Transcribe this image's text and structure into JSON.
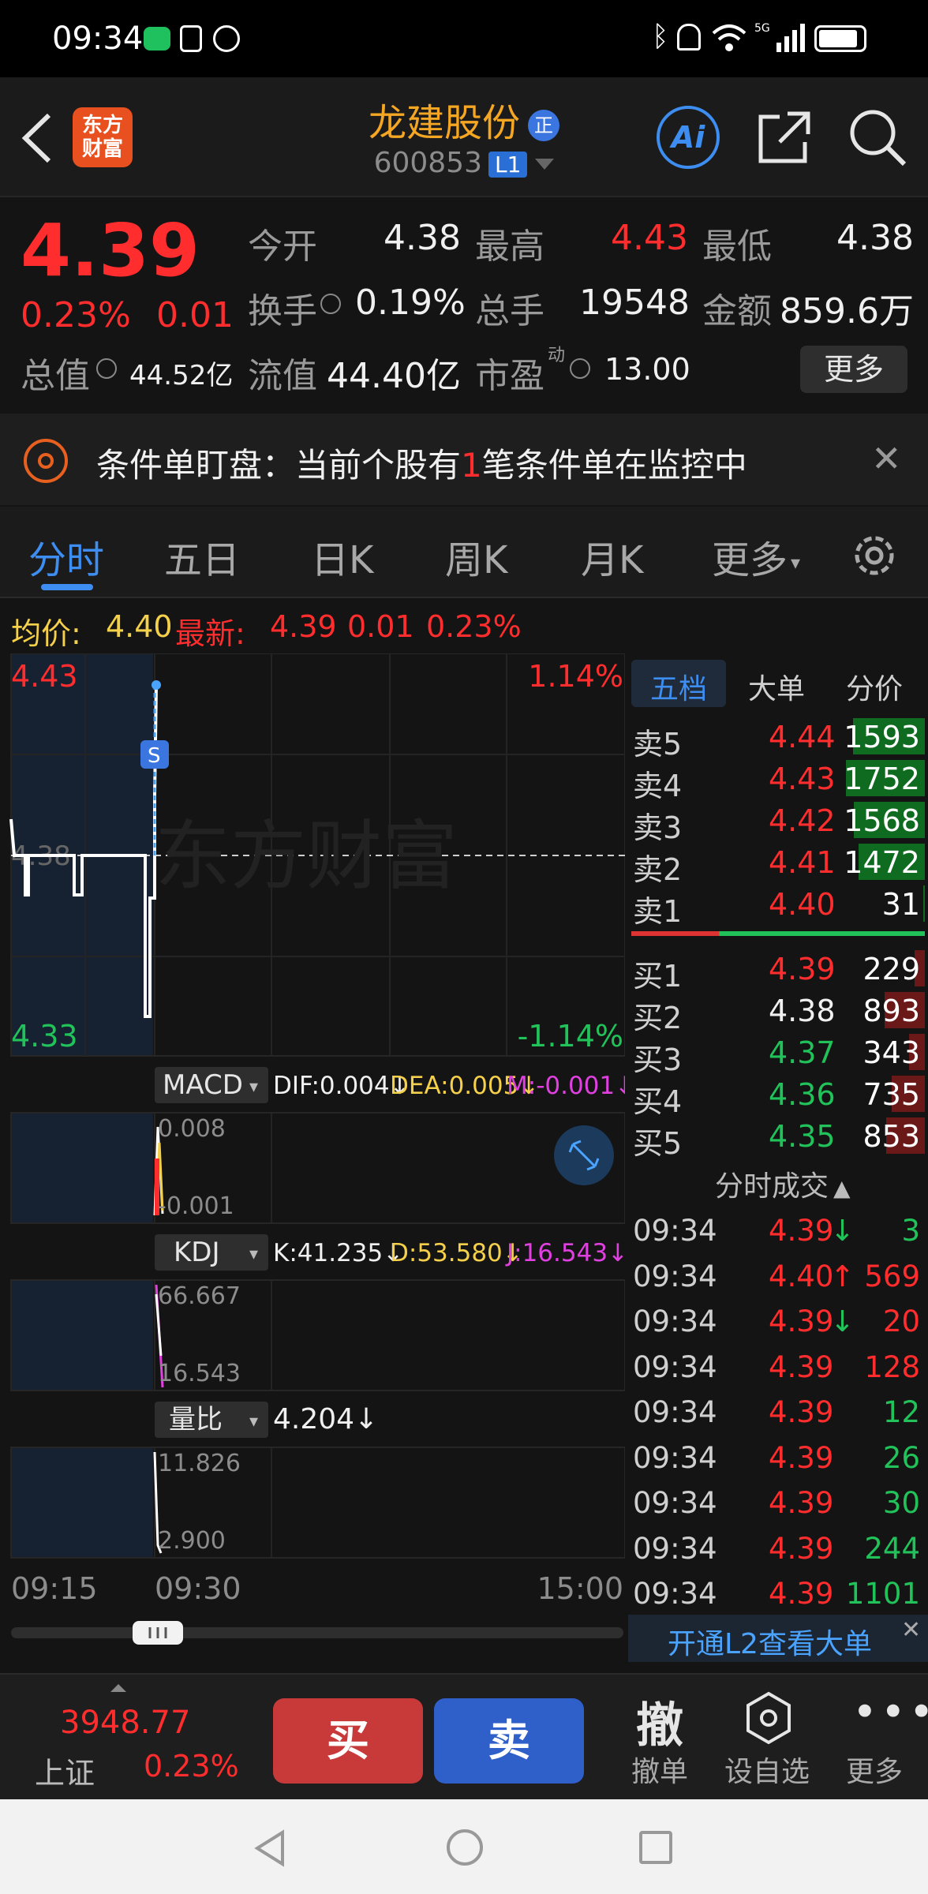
{
  "status_bar": {
    "time": "09:34"
  },
  "header": {
    "app_logo": "东方\n财富",
    "stock_name": "龙建股份",
    "stock_code": "600853",
    "level_badge": "L1",
    "verified_badge": "正"
  },
  "quote": {
    "price": "4.39",
    "change_pct": "0.23%",
    "change": "0.01",
    "open_label": "今开",
    "open": "4.38",
    "high_label": "最高",
    "high": "4.43",
    "low_label": "最低",
    "low": "4.38",
    "turnover_label": "换手",
    "turnover": "0.19%",
    "volume_label": "总手",
    "volume": "19548",
    "amount_label": "金额",
    "amount": "859.6万",
    "mktcap_label": "总值",
    "mktcap": "44.52亿",
    "float_label": "流值",
    "float": "44.40亿",
    "pe_label": "市盈",
    "pe_sup": "动",
    "pe": "13.00",
    "more_button": "更多"
  },
  "banner": {
    "text_pre": "条件单盯盘：当前个股有",
    "count": "1",
    "text_post": "笔条件单在监控中"
  },
  "tabs": [
    "分时",
    "五日",
    "日K",
    "周K",
    "月K",
    "更多"
  ],
  "info_row": {
    "avg_label": "均价:",
    "avg": "4.40",
    "latest_label": "最新:",
    "latest": "4.39",
    "change": "0.01",
    "change_pct": "0.23%"
  },
  "chart": {
    "price_top": "4.43",
    "price_bottom": "4.33",
    "pct_top": "1.14%",
    "pct_bottom": "-1.14%",
    "mid_label": "4.38",
    "watermark": "东方财富",
    "marker": "S",
    "time_start": "09:15",
    "time_mid": "09:30",
    "time_end": "15:00",
    "macd": {
      "name": "MACD",
      "dif": "DIF:0.004↓",
      "dea": "DEA:0.005↓",
      "m": "M:-0.001↓",
      "top": "0.008",
      "bottom": "-0.001"
    },
    "kdj": {
      "name": "KDJ",
      "k": "K:41.235↓",
      "d": "D:53.580↓",
      "j": "J:16.543↓",
      "top": "66.667",
      "bottom": "16.543"
    },
    "lb": {
      "name": "量比",
      "val": "4.204↓",
      "top": "11.826",
      "bottom": "2.900"
    },
    "colors": {
      "up": "#ff2d2d",
      "down": "#22c25a",
      "line": "#ffffff",
      "avg": "#f5d04a"
    }
  },
  "orderbook": {
    "tabs": [
      "五档",
      "大单",
      "分价"
    ],
    "asks": [
      {
        "label": "卖5",
        "price": "4.44",
        "vol": "1593",
        "fill": 0.91
      },
      {
        "label": "卖4",
        "price": "4.43",
        "vol": "1752",
        "fill": 1.0
      },
      {
        "label": "卖3",
        "price": "4.42",
        "vol": "1568",
        "fill": 0.9
      },
      {
        "label": "卖2",
        "price": "4.41",
        "vol": "1472",
        "fill": 0.84
      },
      {
        "label": "卖1",
        "price": "4.40",
        "vol": "31",
        "fill": 0.02
      }
    ],
    "bids": [
      {
        "label": "买1",
        "price": "4.39",
        "vol": "229",
        "fill": 0.13
      },
      {
        "label": "买2",
        "price": "4.38",
        "vol": "893",
        "fill": 0.51
      },
      {
        "label": "买3",
        "price": "4.37",
        "vol": "343",
        "fill": 0.2
      },
      {
        "label": "买4",
        "price": "4.36",
        "vol": "735",
        "fill": 0.42
      },
      {
        "label": "买5",
        "price": "4.35",
        "vol": "853",
        "fill": 0.49
      }
    ],
    "ticks_title": "分时成交",
    "ticks": [
      {
        "time": "09:34",
        "price": "4.39",
        "arrow": "↓",
        "vol": "3",
        "dir": "down"
      },
      {
        "time": "09:34",
        "price": "4.40",
        "arrow": "↑",
        "vol": "569",
        "dir": "up"
      },
      {
        "time": "09:34",
        "price": "4.39",
        "arrow": "↓",
        "vol": "20",
        "dir": "up"
      },
      {
        "time": "09:34",
        "price": "4.39",
        "arrow": "",
        "vol": "128",
        "dir": "up"
      },
      {
        "time": "09:34",
        "price": "4.39",
        "arrow": "",
        "vol": "12",
        "dir": "down"
      },
      {
        "time": "09:34",
        "price": "4.39",
        "arrow": "",
        "vol": "26",
        "dir": "down"
      },
      {
        "time": "09:34",
        "price": "4.39",
        "arrow": "",
        "vol": "30",
        "dir": "down"
      },
      {
        "time": "09:34",
        "price": "4.39",
        "arrow": "",
        "vol": "244",
        "dir": "down"
      },
      {
        "time": "09:34",
        "price": "4.39",
        "arrow": "",
        "vol": "1101",
        "dir": "down"
      }
    ],
    "l2_link": "开通L2查看大单"
  },
  "bottom": {
    "index_value": "3948.77",
    "index_name": "上证",
    "index_pct": "0.23%",
    "buy": "买",
    "sell": "卖",
    "cancel_glyph": "撤",
    "cancel_label": "撤单",
    "watch_label": "设自选",
    "more_label": "更多"
  }
}
